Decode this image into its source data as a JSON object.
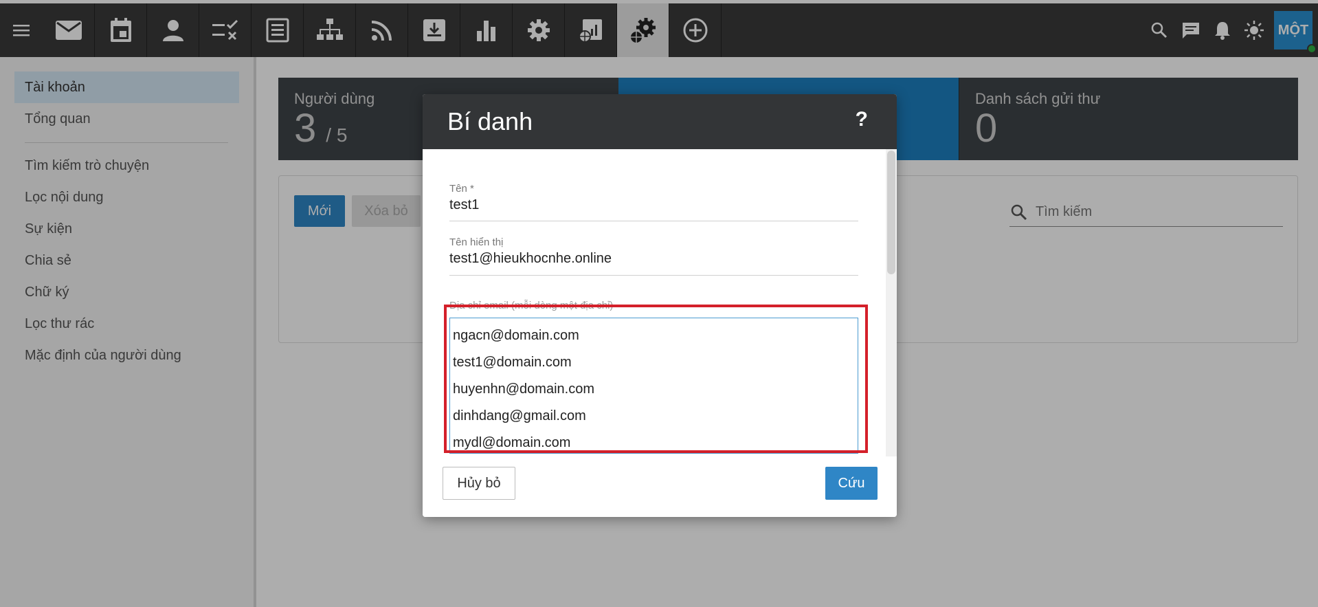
{
  "colors": {
    "topbar": "#3a3a3a",
    "accent": "#2f86c6",
    "highlight": "#d4202a",
    "stat_active": "#1d7fc0",
    "status_online": "#2fb344"
  },
  "topbar": {
    "nav_icons": [
      "mail-icon",
      "calendar-icon",
      "contacts-icon",
      "tasks-icon",
      "notes-icon",
      "org-chart-icon",
      "rss-icon",
      "inbox-download-icon",
      "bar-chart-icon",
      "settings-icon",
      "report-icon",
      "admin-settings-icon",
      "add-icon"
    ],
    "avatar_initials": "MỘT"
  },
  "sidebar": {
    "items": [
      {
        "label": "Tài khoản",
        "active": true
      },
      {
        "label": "Tổng quan"
      },
      {
        "label": "Tìm kiếm trò chuyện"
      },
      {
        "label": "Lọc nội dung"
      },
      {
        "label": "Sự kiện"
      },
      {
        "label": "Chia sẻ"
      },
      {
        "label": "Chữ ký"
      },
      {
        "label": "Lọc thư rác"
      },
      {
        "label": "Mặc định của người dùng"
      }
    ]
  },
  "stats": {
    "users_label": "Người dùng",
    "users_value": "3",
    "users_max": "/ 5",
    "mailing_label": "Danh sách gửi thư",
    "mailing_value": "0"
  },
  "toolbar": {
    "new_label": "Mới",
    "delete_label": "Xóa bỏ",
    "search_placeholder": "Tìm kiếm"
  },
  "dialog": {
    "title": "Bí danh",
    "help": "?",
    "name_label": "Tên *",
    "name_value": "test1",
    "display_label": "Tên hiển thị",
    "display_value": "test1@hieukhocnhe.online",
    "email_label": "Địa chỉ email (mỗi dòng một địa chỉ)",
    "emails": [
      "ngacn@domain.com",
      "test1@domain.com",
      "huyenhn@domain.com",
      "dinhdang@gmail.com",
      "mydl@domain.com"
    ],
    "cancel_label": "Hủy bỏ",
    "save_label": "Cứu"
  }
}
